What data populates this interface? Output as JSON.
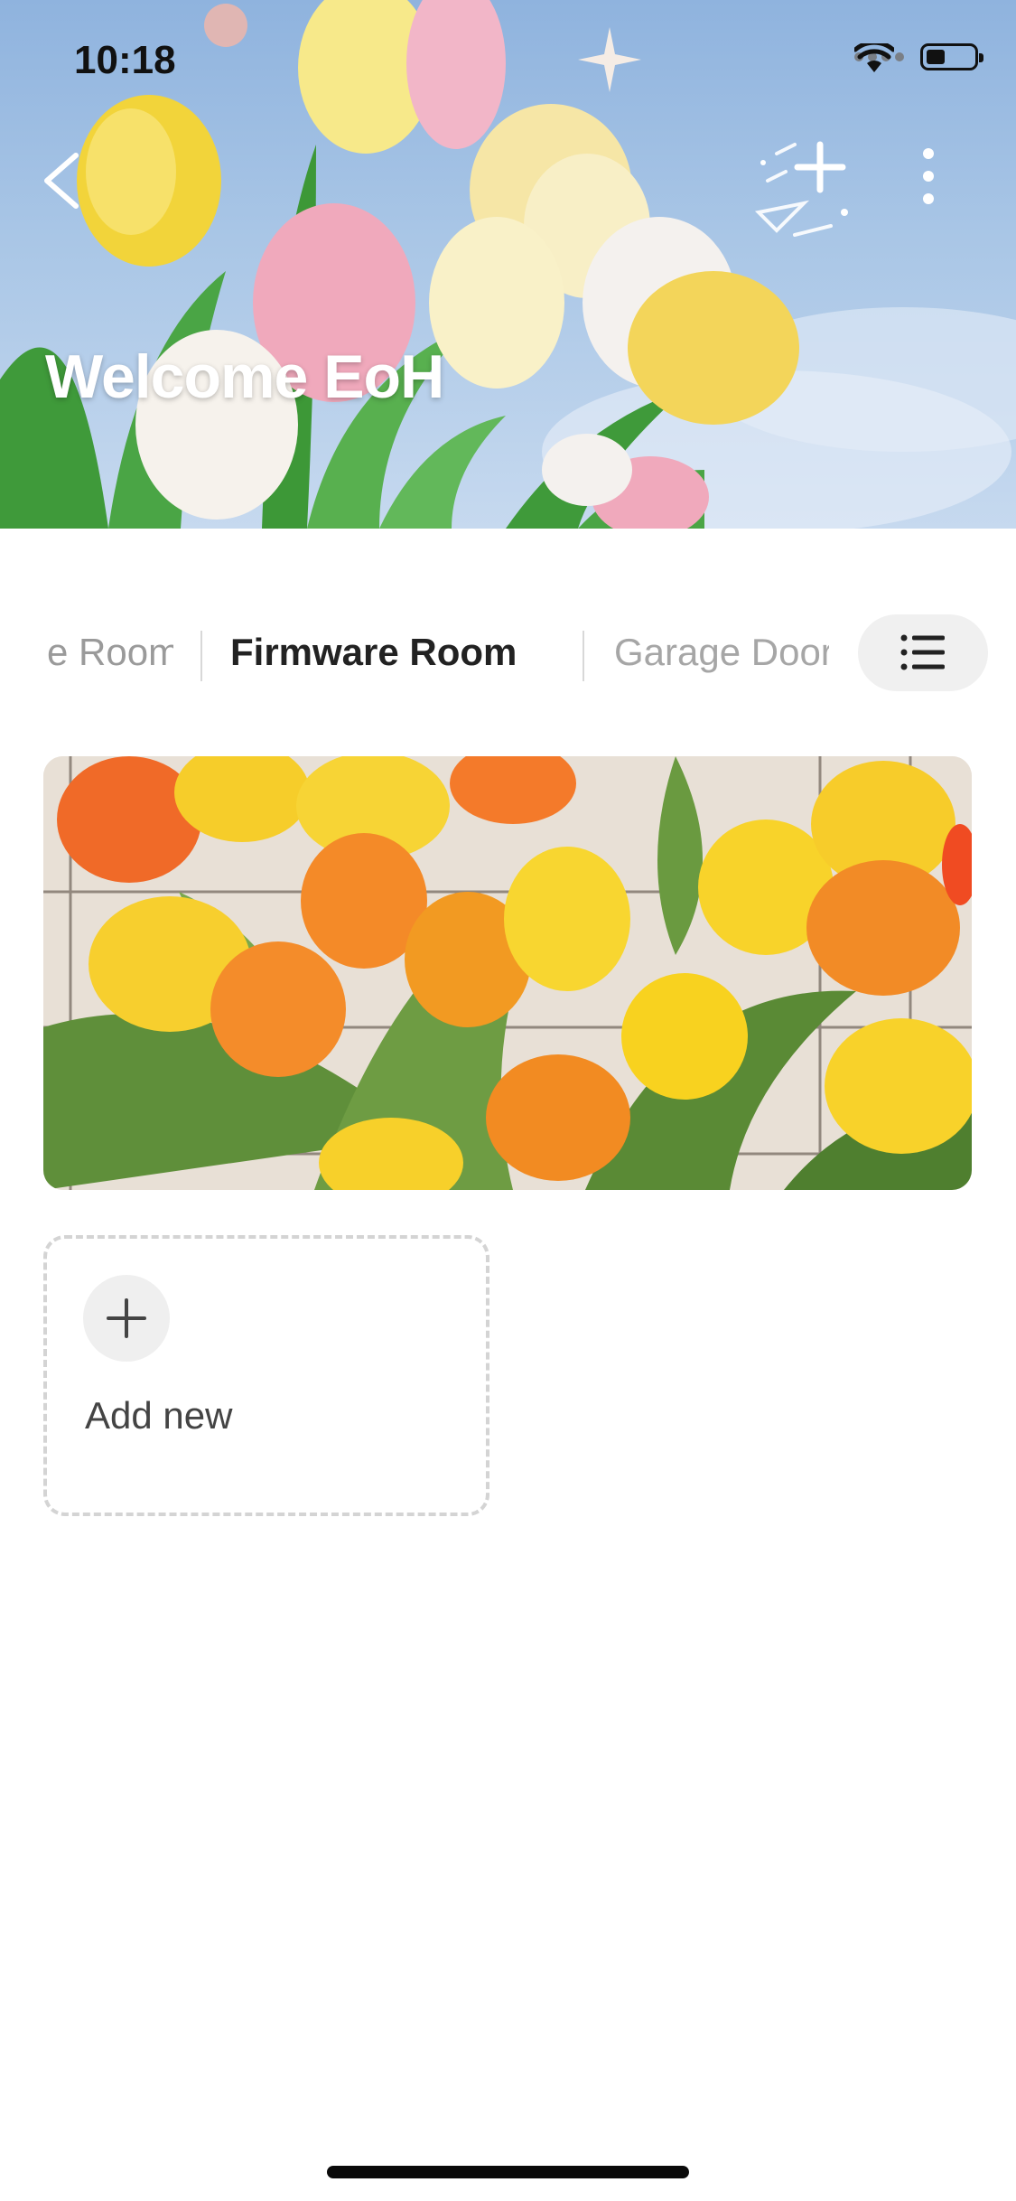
{
  "status_bar": {
    "time": "10:18"
  },
  "header": {
    "title": "Welcome EoH"
  },
  "tabs": {
    "items": [
      {
        "label": "e Room"
      },
      {
        "label": "Firmware Room"
      },
      {
        "label": "Garage Door"
      }
    ],
    "active_index": 1
  },
  "add_card": {
    "label": "Add new"
  },
  "icons": {
    "back": "chevron-left-icon",
    "add": "plus-sparkle-icon",
    "more": "more-vertical-icon",
    "tab_menu": "list-icon",
    "add_new": "plus-icon"
  },
  "colors": {
    "sky": "#a9c6e6",
    "tab_active_text": "#222222",
    "tab_inactive_text": "#9a9a9a",
    "dashed_border": "#d4d4d4"
  }
}
